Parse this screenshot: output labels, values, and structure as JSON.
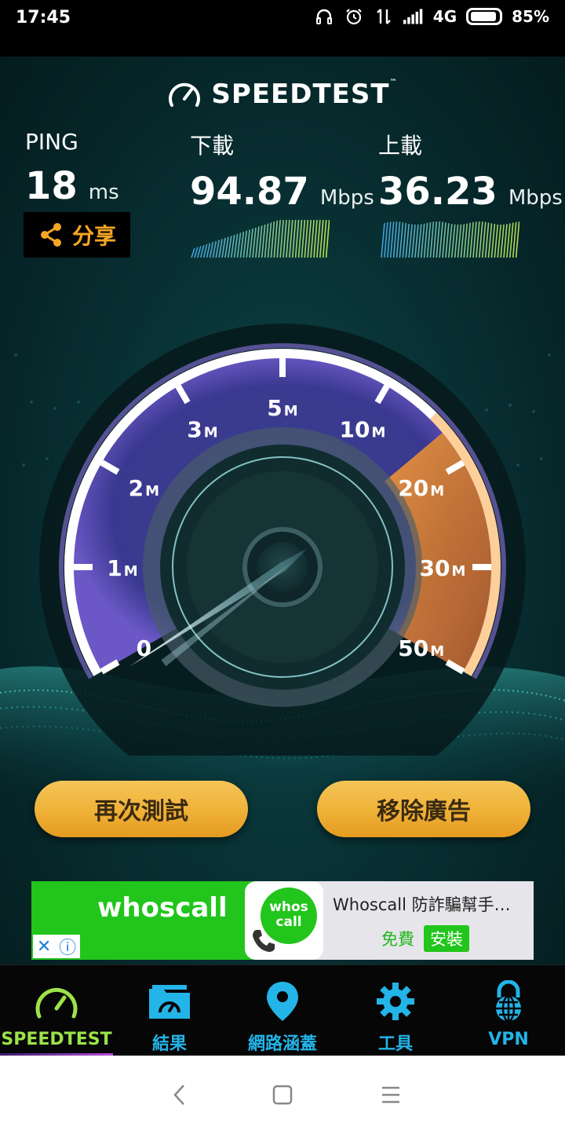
{
  "status_bar": {
    "time": "17:45",
    "network": "4G",
    "battery": "85%"
  },
  "app": {
    "logo_text": "SPEEDTEST",
    "logo_tm": "™"
  },
  "results": {
    "ping": {
      "label": "PING",
      "value": "18",
      "unit": "ms"
    },
    "download": {
      "label": "下載",
      "value": "94.87",
      "unit": "Mbps"
    },
    "upload": {
      "label": "上載",
      "value": "36.23",
      "unit": "Mbps"
    }
  },
  "share": {
    "label": "分享",
    "icon": "share-icon"
  },
  "gauge": {
    "ticks": [
      {
        "num": "0",
        "unit": ""
      },
      {
        "num": "1",
        "unit": "M"
      },
      {
        "num": "2",
        "unit": "M"
      },
      {
        "num": "3",
        "unit": "M"
      },
      {
        "num": "5",
        "unit": "M"
      },
      {
        "num": "10",
        "unit": "M"
      },
      {
        "num": "20",
        "unit": "M"
      },
      {
        "num": "30",
        "unit": "M"
      },
      {
        "num": "50",
        "unit": "M"
      }
    ],
    "needle_value": "0",
    "colors": {
      "purple": "#7b5fd0",
      "orange": "#f08a3a",
      "ring": "#ffffff"
    }
  },
  "actions": {
    "retest": "再次測試",
    "remove_ads": "移除廣告"
  },
  "ad": {
    "brand": "whoscall",
    "logo_line1": "whos",
    "logo_line2": "call",
    "title": "Whoscall 防詐騙幫手…",
    "free": "免費",
    "install": "安裝",
    "close": "✕",
    "info": "ⓘ"
  },
  "tabs": [
    {
      "label": "SPEEDTEST",
      "icon": "speedometer-icon",
      "active": true
    },
    {
      "label": "結果",
      "icon": "results-folder-icon",
      "active": false
    },
    {
      "label": "網路涵蓋",
      "icon": "map-pin-icon",
      "active": false
    },
    {
      "label": "工具",
      "icon": "gear-icon",
      "active": false
    },
    {
      "label": "VPN",
      "icon": "vpn-lock-icon",
      "active": false
    }
  ],
  "colors": {
    "accent_green": "#9be34a",
    "accent_blue": "#23b4e8",
    "button_gold": "#f0b33a"
  }
}
